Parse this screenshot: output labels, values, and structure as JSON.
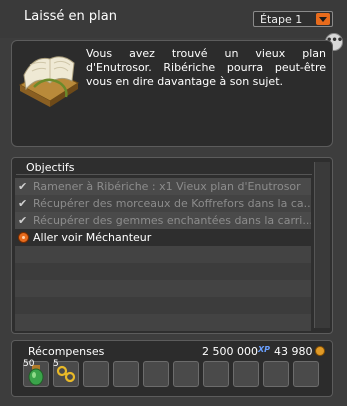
{
  "header": {
    "title": "Laissé en plan",
    "step_label": "Étape 1"
  },
  "description": {
    "icon": "old-map-scroll-icon",
    "text": "Vous avez trouvé un vieux plan d'Enutrosor. Ribériche pourra peut-être vous en dire davantage à son sujet."
  },
  "more_button": {
    "label": "•••"
  },
  "objectives": {
    "title": "Objectifs",
    "items": [
      {
        "text": "Ramener à Ribériche : x1 Vieux plan d'Enutrosor",
        "status": "done"
      },
      {
        "text": "Récupérer des morceaux de Koffrefors dans la ca...",
        "status": "done"
      },
      {
        "text": "Récupérer des gemmes enchantées dans la carri...",
        "status": "done"
      },
      {
        "text": "Aller voir Méchanteur",
        "status": "active"
      }
    ]
  },
  "rewards": {
    "title": "Récompenses",
    "xp": "2 500 000",
    "xp_label": "XP",
    "kamas": "43 980",
    "items": [
      {
        "quantity": "50",
        "icon": "green-potion-icon"
      },
      {
        "quantity": "5",
        "icon": "golden-key-icon"
      }
    ],
    "colors": {
      "accent": "#e86b1c"
    }
  }
}
